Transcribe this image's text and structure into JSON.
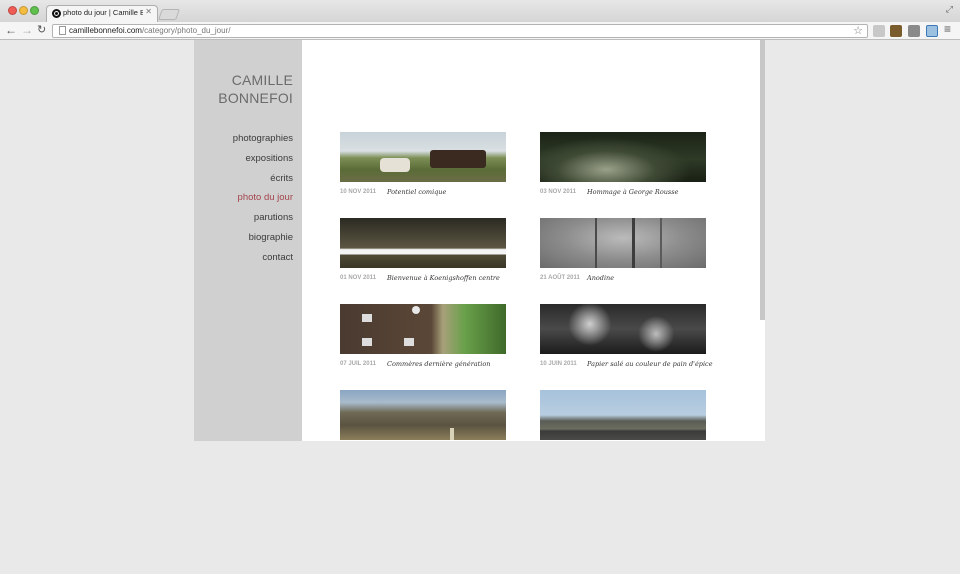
{
  "browser": {
    "tab_title": "photo du jour | Camille Bo",
    "url_host": "camillebonnefoi.com",
    "url_path": "/category/photo_du_jour/"
  },
  "site": {
    "name_line1": "CAMILLE",
    "name_line2": "BONNEFOI"
  },
  "nav": [
    {
      "label": "photographies",
      "active": false
    },
    {
      "label": "expositions",
      "active": false
    },
    {
      "label": "écrits",
      "active": false
    },
    {
      "label": "photo du jour",
      "active": true
    },
    {
      "label": "parutions",
      "active": false
    },
    {
      "label": "biographie",
      "active": false
    },
    {
      "label": "contact",
      "active": false
    }
  ],
  "posts": [
    {
      "date": "10 NOV 2011",
      "title": "Potentiel comique"
    },
    {
      "date": "03 NOV 2011",
      "title": "Hommage à George Rousse"
    },
    {
      "date": "01 NOV 2011",
      "title": "Bienvenue à Koenigshoffen centre"
    },
    {
      "date": "21 AOÛT 2011",
      "title": "Anodine"
    },
    {
      "date": "07 JUIL 2011",
      "title": "Commères dernière génération"
    },
    {
      "date": "10 JUIN 2011",
      "title": "Papier salé au couleur de pain d'épice"
    },
    {
      "date": "",
      "title": ""
    },
    {
      "date": "",
      "title": ""
    }
  ],
  "colors": {
    "active_nav": "#a3444b",
    "sidebar_bg": "#d0d0d0",
    "page_bg": "#e9e9e9"
  }
}
